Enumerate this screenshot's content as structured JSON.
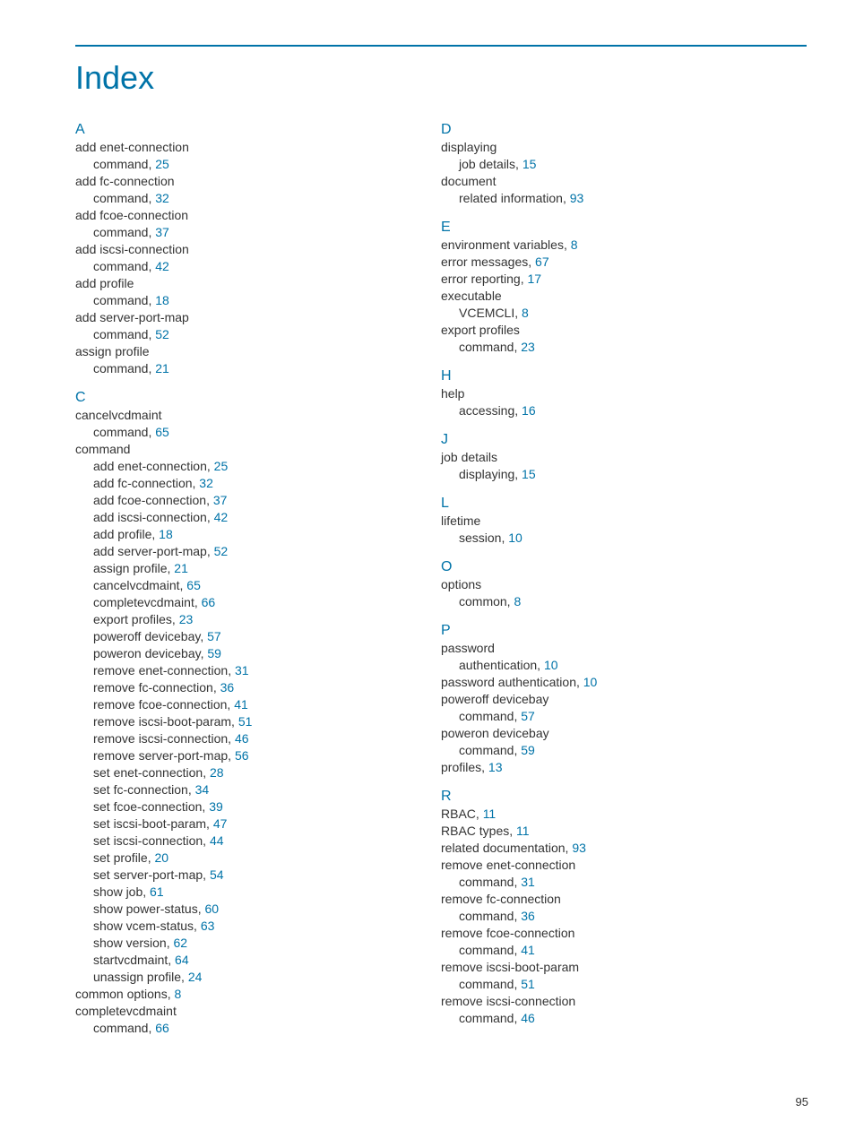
{
  "title": "Index",
  "page_number": "95",
  "left_sections": [
    {
      "letter": "A",
      "entries": [
        {
          "text": "add enet-connection"
        },
        {
          "text": "command, ",
          "page": "25",
          "sub": true
        },
        {
          "text": "add fc-connection"
        },
        {
          "text": "command, ",
          "page": "32",
          "sub": true
        },
        {
          "text": "add fcoe-connection"
        },
        {
          "text": "command, ",
          "page": "37",
          "sub": true
        },
        {
          "text": "add iscsi-connection"
        },
        {
          "text": "command, ",
          "page": "42",
          "sub": true
        },
        {
          "text": "add profile"
        },
        {
          "text": "command, ",
          "page": "18",
          "sub": true
        },
        {
          "text": "add server-port-map"
        },
        {
          "text": "command, ",
          "page": "52",
          "sub": true
        },
        {
          "text": "assign profile"
        },
        {
          "text": "command, ",
          "page": "21",
          "sub": true
        }
      ]
    },
    {
      "letter": "C",
      "entries": [
        {
          "text": "cancelvcdmaint"
        },
        {
          "text": "command, ",
          "page": "65",
          "sub": true
        },
        {
          "text": "command"
        },
        {
          "text": "add enet-connection, ",
          "page": "25",
          "sub": true
        },
        {
          "text": "add fc-connection, ",
          "page": "32",
          "sub": true
        },
        {
          "text": "add fcoe-connection, ",
          "page": "37",
          "sub": true
        },
        {
          "text": "add iscsi-connection, ",
          "page": "42",
          "sub": true
        },
        {
          "text": "add profile, ",
          "page": "18",
          "sub": true
        },
        {
          "text": "add server-port-map, ",
          "page": "52",
          "sub": true
        },
        {
          "text": "assign profile, ",
          "page": "21",
          "sub": true
        },
        {
          "text": "cancelvcdmaint, ",
          "page": "65",
          "sub": true
        },
        {
          "text": "completevcdmaint, ",
          "page": "66",
          "sub": true
        },
        {
          "text": "export profiles, ",
          "page": "23",
          "sub": true
        },
        {
          "text": "poweroff devicebay, ",
          "page": "57",
          "sub": true
        },
        {
          "text": "poweron devicebay, ",
          "page": "59",
          "sub": true
        },
        {
          "text": "remove enet-connection, ",
          "page": "31",
          "sub": true
        },
        {
          "text": "remove fc-connection, ",
          "page": "36",
          "sub": true
        },
        {
          "text": "remove fcoe-connection, ",
          "page": "41",
          "sub": true
        },
        {
          "text": "remove iscsi-boot-param, ",
          "page": "51",
          "sub": true
        },
        {
          "text": "remove iscsi-connection, ",
          "page": "46",
          "sub": true
        },
        {
          "text": "remove server-port-map, ",
          "page": "56",
          "sub": true
        },
        {
          "text": "set enet-connection, ",
          "page": "28",
          "sub": true
        },
        {
          "text": "set fc-connection, ",
          "page": "34",
          "sub": true
        },
        {
          "text": "set fcoe-connection, ",
          "page": "39",
          "sub": true
        },
        {
          "text": "set iscsi-boot-param, ",
          "page": "47",
          "sub": true
        },
        {
          "text": "set iscsi-connection, ",
          "page": "44",
          "sub": true
        },
        {
          "text": "set profile, ",
          "page": "20",
          "sub": true
        },
        {
          "text": "set server-port-map, ",
          "page": "54",
          "sub": true
        },
        {
          "text": "show job, ",
          "page": "61",
          "sub": true
        },
        {
          "text": "show power-status, ",
          "page": "60",
          "sub": true
        },
        {
          "text": "show vcem-status, ",
          "page": "63",
          "sub": true
        },
        {
          "text": "show version, ",
          "page": "62",
          "sub": true
        },
        {
          "text": "startvcdmaint, ",
          "page": "64",
          "sub": true
        },
        {
          "text": "unassign profile, ",
          "page": "24",
          "sub": true
        },
        {
          "text": "common options, ",
          "page": "8"
        },
        {
          "text": "completevcdmaint"
        },
        {
          "text": "command, ",
          "page": "66",
          "sub": true
        }
      ]
    }
  ],
  "right_sections": [
    {
      "letter": "D",
      "entries": [
        {
          "text": "displaying"
        },
        {
          "text": "job details, ",
          "page": "15",
          "sub": true
        },
        {
          "text": "document"
        },
        {
          "text": "related information, ",
          "page": "93",
          "sub": true
        }
      ]
    },
    {
      "letter": "E",
      "entries": [
        {
          "text": "environment variables, ",
          "page": "8"
        },
        {
          "text": "error messages, ",
          "page": "67"
        },
        {
          "text": "error reporting, ",
          "page": "17"
        },
        {
          "text": "executable"
        },
        {
          "text": "VCEMCLI, ",
          "page": "8",
          "sub": true
        },
        {
          "text": "export profiles"
        },
        {
          "text": "command, ",
          "page": "23",
          "sub": true
        }
      ]
    },
    {
      "letter": "H",
      "entries": [
        {
          "text": "help"
        },
        {
          "text": "accessing, ",
          "page": "16",
          "sub": true
        }
      ]
    },
    {
      "letter": "J",
      "entries": [
        {
          "text": "job details"
        },
        {
          "text": "displaying, ",
          "page": "15",
          "sub": true
        }
      ]
    },
    {
      "letter": "L",
      "entries": [
        {
          "text": "lifetime"
        },
        {
          "text": "session, ",
          "page": "10",
          "sub": true
        }
      ]
    },
    {
      "letter": "O",
      "entries": [
        {
          "text": "options"
        },
        {
          "text": "common, ",
          "page": "8",
          "sub": true
        }
      ]
    },
    {
      "letter": "P",
      "entries": [
        {
          "text": "password"
        },
        {
          "text": "authentication, ",
          "page": "10",
          "sub": true
        },
        {
          "text": "password authentication, ",
          "page": "10"
        },
        {
          "text": "poweroff devicebay"
        },
        {
          "text": "command, ",
          "page": "57",
          "sub": true
        },
        {
          "text": "poweron devicebay"
        },
        {
          "text": "command, ",
          "page": "59",
          "sub": true
        },
        {
          "text": "profiles, ",
          "page": "13"
        }
      ]
    },
    {
      "letter": "R",
      "entries": [
        {
          "text": "RBAC, ",
          "page": "11"
        },
        {
          "text": "RBAC types, ",
          "page": "11"
        },
        {
          "text": "related documentation, ",
          "page": "93"
        },
        {
          "text": "remove enet-connection"
        },
        {
          "text": "command, ",
          "page": "31",
          "sub": true
        },
        {
          "text": "remove fc-connection"
        },
        {
          "text": "command, ",
          "page": "36",
          "sub": true
        },
        {
          "text": "remove fcoe-connection"
        },
        {
          "text": "command, ",
          "page": "41",
          "sub": true
        },
        {
          "text": "remove iscsi-boot-param"
        },
        {
          "text": "command, ",
          "page": "51",
          "sub": true
        },
        {
          "text": "remove iscsi-connection"
        },
        {
          "text": "command, ",
          "page": "46",
          "sub": true
        }
      ]
    }
  ]
}
